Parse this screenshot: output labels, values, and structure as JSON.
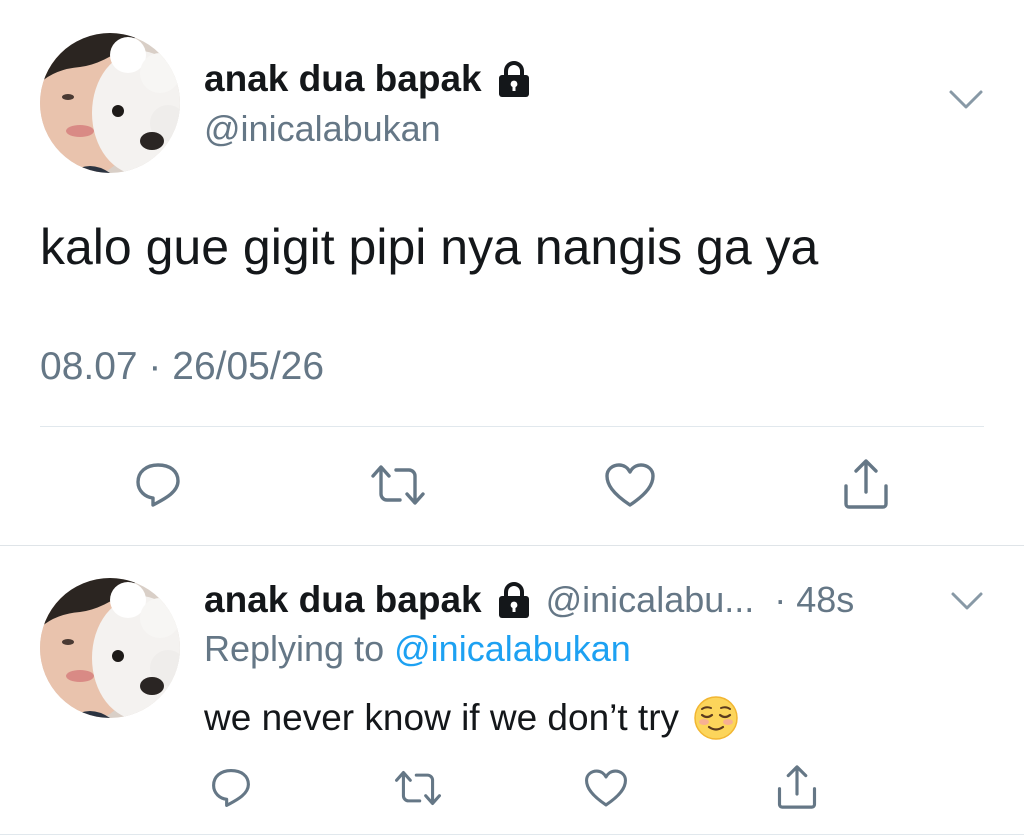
{
  "main_tweet": {
    "display_name": "anak dua bapak",
    "handle": "@inicalabukan",
    "text": "kalo gue gigit pipi nya nangis ga ya",
    "timestamp": "08.07 · 26/05/26",
    "icons": {
      "lock": "lock-icon",
      "menu": "chevron-down-icon",
      "reply": "reply-icon",
      "retweet": "retweet-icon",
      "like": "heart-icon",
      "share": "share-icon"
    }
  },
  "reply_tweet": {
    "display_name": "anak dua bapak",
    "handle": "@inicalabu...",
    "time": "· 48s",
    "replying_prefix": "Replying to",
    "replying_to": "@inicalabukan",
    "text": "we never know if we don’t try",
    "emoji": "relieved-face-emoji"
  },
  "colors": {
    "primary_text": "#14171a",
    "secondary_text": "#657786",
    "link": "#1da1f2",
    "divider": "#e1e8ed",
    "icon": "#657786"
  }
}
